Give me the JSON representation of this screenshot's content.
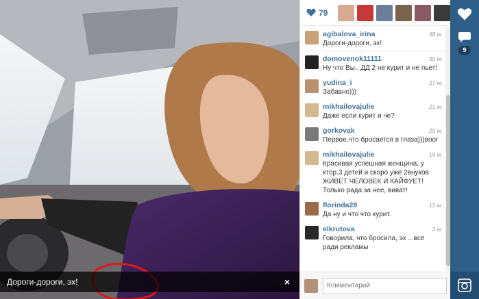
{
  "photo": {
    "caption": "Дороги-дороги, эх!",
    "close_glyph": "×"
  },
  "likes": {
    "count": "79",
    "likers": [
      {
        "name": "liker-1",
        "color": "#d8a890"
      },
      {
        "name": "liker-2",
        "color": "#c43a3a"
      },
      {
        "name": "liker-3",
        "color": "#6b7f9a"
      },
      {
        "name": "liker-4",
        "color": "#7a6450"
      },
      {
        "name": "liker-5",
        "color": "#8a5a64"
      },
      {
        "name": "liker-6",
        "color": "#3a3a3a"
      }
    ]
  },
  "caption_comment": {
    "user": "agibalova_irina",
    "time": "48 м.",
    "text": "Дороги-дороги, эх!",
    "avatar_color": "#c9a078"
  },
  "comments": [
    {
      "user": "domovenok11111",
      "time": "30 м.",
      "text": "Ну что Вы.. ДД 2 не курит и не пьет!",
      "avatar_color": "#222222"
    },
    {
      "user": "yudina_i",
      "time": "27 м.",
      "text": "Забавно)))",
      "avatar_color": "#b89070"
    },
    {
      "user": "mikhailovajulie",
      "time": "21 м.",
      "text": "Даже если курит и че?",
      "avatar_color": "#d4b890"
    },
    {
      "user": "gorkovak",
      "time": "20 м.",
      "text": "Первое,что бросается в глаза)))вooг",
      "avatar_color": "#7a7a7a"
    },
    {
      "user": "mikhailovajulie",
      "time": "19 м.",
      "text": "Красивая успешная женщина, у ктор.3 детей и скоро уже 2внуков ЖИВЕТ ЧЕЛОВЕК И КАЙФУЕТ! Только рада за нее, виват!",
      "avatar_color": "#d4b890"
    },
    {
      "user": "florinda28",
      "time": "12 м.",
      "text": "Да ну и что что курит.",
      "avatar_color": "#9c6a4a"
    },
    {
      "user": "elkrutova",
      "time": "2 м.",
      "text": "Говорила, что бросила, эх ...все ради рекламы",
      "avatar_color": "#2a2a2a"
    }
  ],
  "comment_input": {
    "placeholder": "Комментарий",
    "avatar_color": "#b4917a"
  },
  "side": {
    "comment_count": "9",
    "heart_icon": "heart-icon",
    "comment_icon": "speech-bubble-icon",
    "camera_icon": "camera-icon"
  },
  "colors": {
    "link": "#3f729b",
    "side_bg": "#2f5f89"
  }
}
